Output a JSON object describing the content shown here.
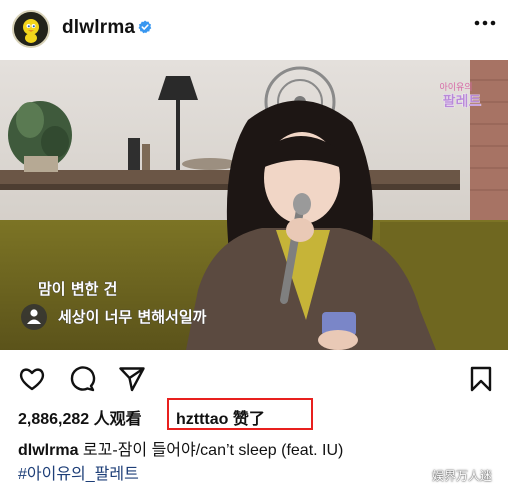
{
  "post": {
    "username": "dlwlrma",
    "verified_icon": "verified-badge-icon",
    "more_icon": "more-dots-icon"
  },
  "video": {
    "channel_logo_text": "팔레트",
    "channel_logo_small": "아이유의",
    "subtitle_line1": "맘이 변한 건",
    "subtitle_line2": "세상이 너무 변해서일까",
    "audio_icon": "user-tag-icon"
  },
  "actions": {
    "like_icon": "heart-icon",
    "comment_icon": "comment-icon",
    "share_icon": "send-icon",
    "save_icon": "bookmark-icon"
  },
  "stats": {
    "views": "2,886,282 人观看",
    "liked_by_user": "hztttao",
    "liked_suffix": "赞了",
    "highlight_color": "#e8201e"
  },
  "caption": {
    "username": "dlwlrma",
    "text": "로꼬-잠이 들어야/can’t sleep (feat. IU)",
    "hashtag": "#아이유의_팔레트"
  },
  "watermark": "娱界万人迷"
}
